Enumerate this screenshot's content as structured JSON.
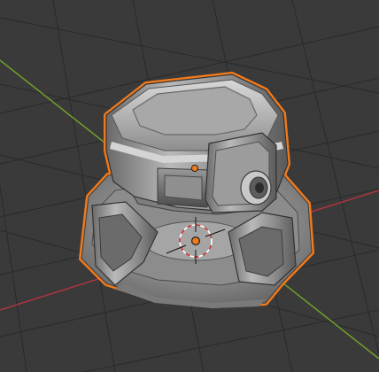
{
  "viewport": {
    "background_color": "#3a3a3a",
    "grid_color": "#2a2a2a",
    "x_axis_color": "#b6343f",
    "y_axis_color": "#6f9a2c"
  },
  "object": {
    "selection_outline_color": "#f07a1c",
    "origin_color": "#f07a1c"
  },
  "cursor_3d": {
    "icon": "3d-cursor-icon",
    "ring_colors": [
      "#d23535",
      "#ffffff"
    ]
  }
}
